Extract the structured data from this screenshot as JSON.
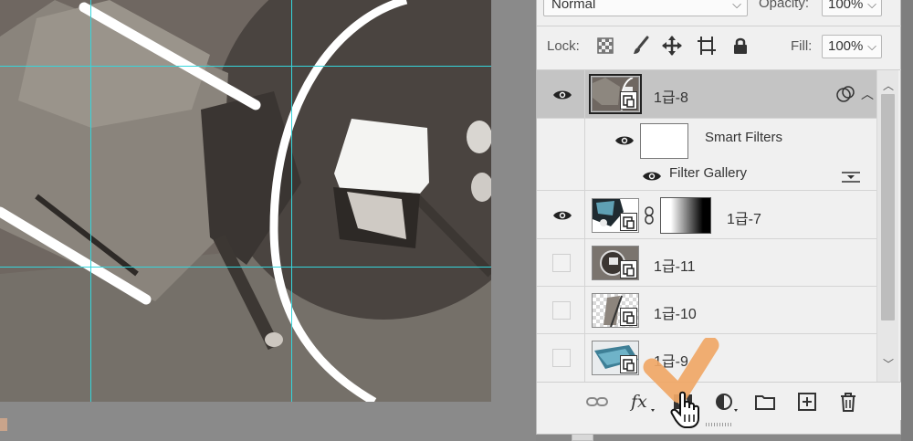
{
  "layers_panel": {
    "blend_mode": "Normal",
    "opacity_label": "Opacity:",
    "opacity_value": "100%",
    "lock_label": "Lock:",
    "fill_label": "Fill:",
    "fill_value": "100%",
    "layers": [
      {
        "name": "1급-8",
        "visible": true,
        "selected": true,
        "smart_object": true,
        "has_smart_filters": true
      },
      {
        "name": "Smart Filters",
        "type": "smart-filters-group",
        "visible": true
      },
      {
        "name": "Filter Gallery",
        "type": "filter",
        "visible": true
      },
      {
        "name": "1급-7",
        "visible": true,
        "smart_object": true,
        "has_mask": true
      },
      {
        "name": "1급-11",
        "visible": false,
        "smart_object": true
      },
      {
        "name": "1급-10",
        "visible": false,
        "smart_object": true
      },
      {
        "name": "1급-9",
        "visible": false,
        "smart_object": true
      }
    ],
    "footer_icons": [
      "link-layers-icon",
      "fx-icon",
      "add-mask-icon",
      "adjustment-layer-icon",
      "new-group-icon",
      "new-layer-icon",
      "delete-icon"
    ]
  },
  "colors": {
    "guide": "#35d6dc",
    "annotation_check": "#f0a766",
    "panel_bg": "#f0f0f0",
    "selected_row": "#c4c4c4"
  }
}
